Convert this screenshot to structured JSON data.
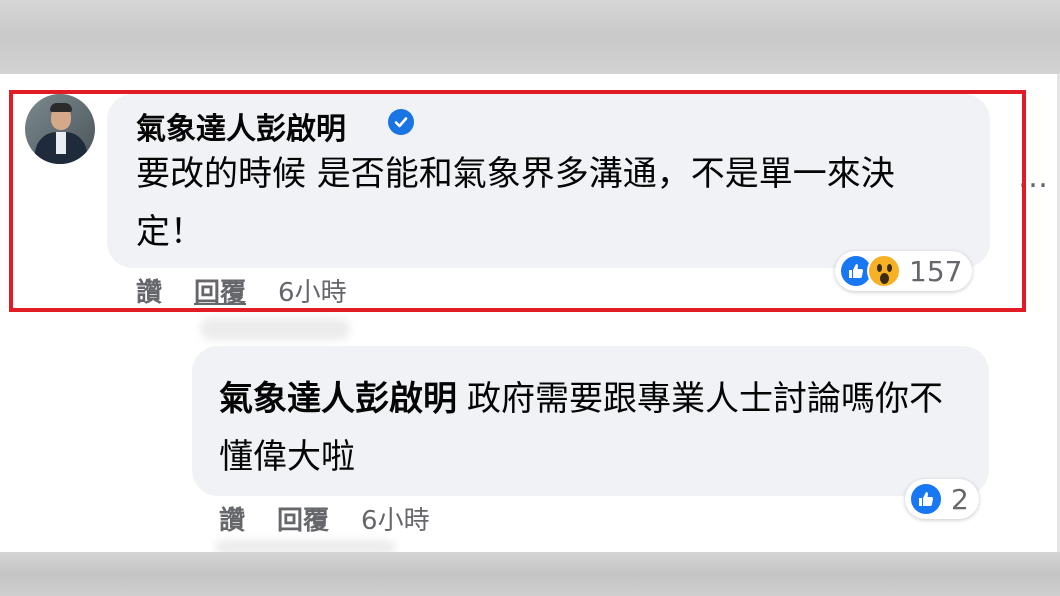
{
  "comment": {
    "author": "氣象達人彭啟明",
    "text": "要改的時候 是否能和氣象界多溝通，不是單一來決定！",
    "reaction_count": "157",
    "reactions": [
      "like-icon",
      "wow-icon"
    ],
    "actions": {
      "like": "讚",
      "reply": "回覆",
      "time": "6小時"
    }
  },
  "reply": {
    "mention": "氣象達人彭啟明",
    "text": "政府需要跟專業人士討論嗎你不懂偉大啦",
    "reaction_count": "2",
    "reactions": [
      "like-icon"
    ],
    "actions": {
      "like": "讚",
      "reply": "回覆",
      "time": "6小時"
    }
  },
  "more_menu": "…",
  "colors": {
    "highlight": "#e21c24",
    "bubble": "#f0f2f5",
    "like_blue": "#1877f2",
    "verified_blue": "#1b74e4"
  }
}
